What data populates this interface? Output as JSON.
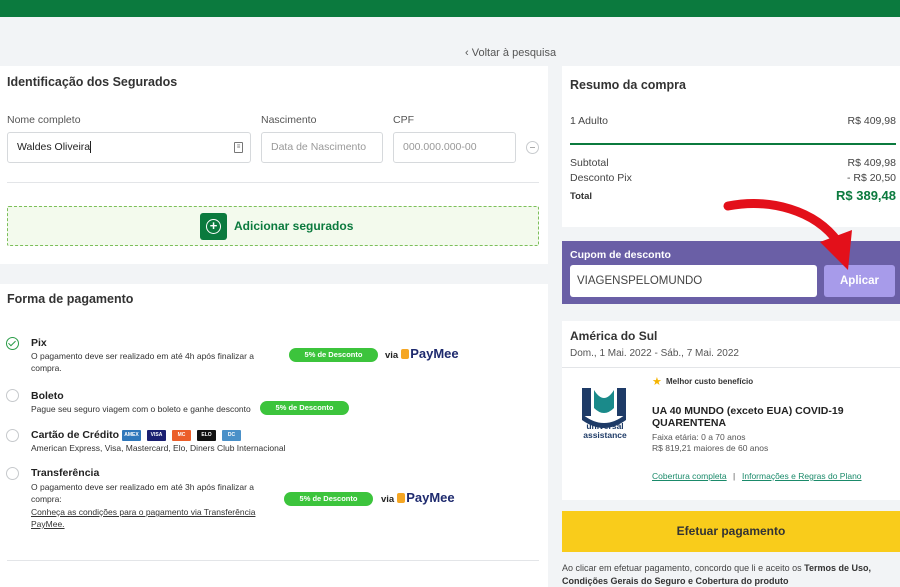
{
  "header": {
    "back_link": "‹ Voltar à pesquisa"
  },
  "insured": {
    "title": "Identificação dos Segurados",
    "name_label": "Nome completo",
    "name_value": "Waldes Oliveira",
    "birth_label": "Nascimento",
    "birth_placeholder": "Data de Nascimento",
    "cpf_label": "CPF",
    "cpf_placeholder": "000.000.000-00",
    "add_button": "Adicionar segurados"
  },
  "payment": {
    "title": "Forma de pagamento",
    "pix": {
      "title": "Pix",
      "desc_line1": "O pagamento deve ser realizado em até 4h após finalizar a",
      "desc_line2": "compra.",
      "badge": "5% de Desconto",
      "via": "via",
      "brand": "PayMee"
    },
    "boleto": {
      "title": "Boleto",
      "desc": "Pague seu seguro viagem com o boleto e ganhe desconto",
      "badge": "5% de Desconto"
    },
    "credit": {
      "title": "Cartão de Crédito",
      "desc": "American Express, Visa, Mastercard, Elo, Diners Club Internacional",
      "card_icons": [
        "AMEX",
        "VISA",
        "MC",
        "ELO",
        "DC"
      ]
    },
    "transfer": {
      "title": "Transferência",
      "desc_line1": "O pagamento deve ser realizado em até 3h após finalizar a",
      "desc_line2": "compra:",
      "link_line1": "Conheça as condições para o pagamento via Transferência",
      "link_line2": "PayMee.",
      "badge": "5% de Desconto",
      "via": "via",
      "brand": "PayMee"
    }
  },
  "summary": {
    "title": "Resumo da compra",
    "adults_label": "1 Adulto",
    "adults_value": "R$ 409,98",
    "subtotal_label": "Subtotal",
    "subtotal_value": "R$ 409,98",
    "discount_label": "Desconto Pix",
    "discount_value": "- R$ 20,50",
    "total_label": "Total",
    "total_value": "R$ 389,48"
  },
  "coupon": {
    "label": "Cupom de desconto",
    "value": "VIAGENSPELOMUNDO",
    "apply_button": "Aplicar"
  },
  "trip": {
    "destination": "América do Sul",
    "dates": "Dom., 1 Mai. 2022 - Sáb., 7 Mai. 2022",
    "best_label": "Melhor custo benefício",
    "logo_text_1": "universal",
    "logo_text_2": "assistance",
    "plan_line1": "UA 40 MUNDO (exceto EUA) COVID-19",
    "plan_line2": "QUARENTENA",
    "age_range": "Faixa etária: 0 a 70 anos",
    "senior_price": "R$ 819,21 maiores de 60 anos",
    "coverage_link": "Cobertura completa",
    "separator": "|",
    "rules_link": "Informações e Regras do Plano"
  },
  "checkout": {
    "pay_button": "Efetuar pagamento",
    "terms_prefix": "Ao clicar em efetuar pagamento, concordo que li e aceito os ",
    "terms_bold1": "Termos de Uso,",
    "terms_bold2": "Condições Gerais do Seguro e Cobertura do produto"
  },
  "colors": {
    "brand_green": "#0b7a3e",
    "coupon_bg": "#6a5fa6",
    "apply_bg": "#a79bea",
    "pay_yellow": "#f9cc1b",
    "badge_green": "#3cc43c",
    "arrow_red": "#e3101a"
  }
}
